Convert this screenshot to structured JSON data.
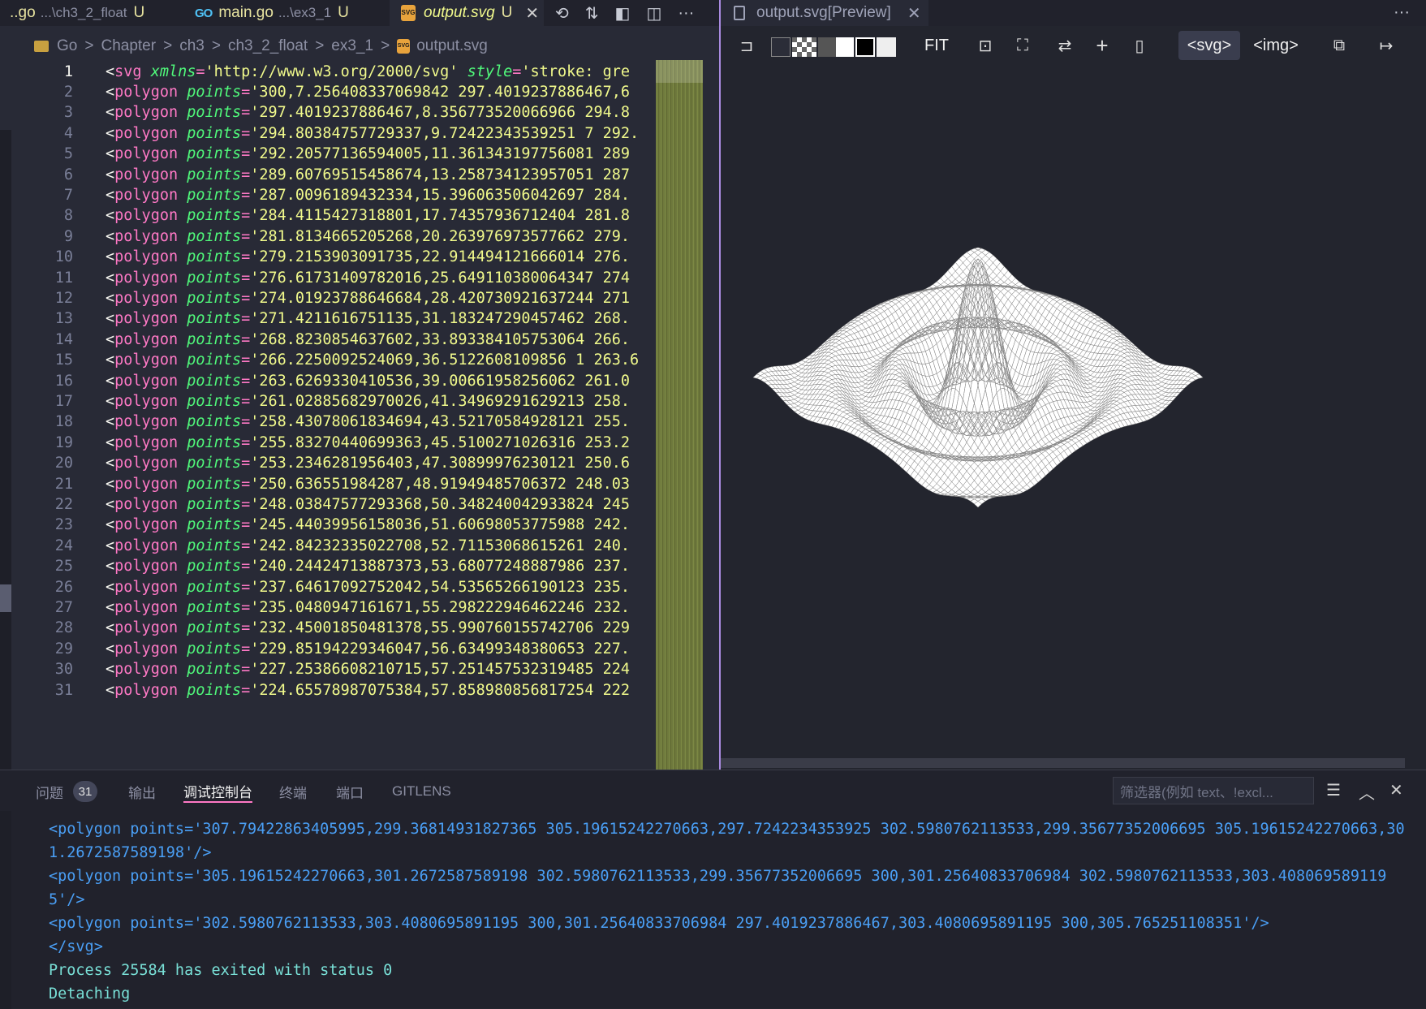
{
  "tabs": [
    {
      "name": "..go",
      "path": "...\\ch3_2_float",
      "mod": "U",
      "icon": "go-icon"
    },
    {
      "name": "main.go",
      "path": "...\\ex3_1",
      "mod": "U",
      "icon": "go-icon"
    },
    {
      "name": "output.svg",
      "path": "",
      "mod": "U",
      "icon": "svg-icon",
      "close": "✕"
    }
  ],
  "editor_actions_more": "···",
  "breadcrumb": [
    "Go",
    "Chapter",
    "ch3",
    "ch3_2_float",
    "ex3_1",
    "output.svg"
  ],
  "breadcrumb_sep": ">",
  "svg_badge": "SVG",
  "go_badge": "GO",
  "code_lines": [
    {
      "n": "1",
      "pre": "<",
      "tag": "svg",
      "a1": "xmlns",
      "v1": "'http://www.w3.org/2000/svg'",
      "a2": "style",
      "v2": "'stroke: gre"
    },
    {
      "n": "2",
      "val": "'300,7.256408337069842 297.4019237886467,6"
    },
    {
      "n": "3",
      "val": "'297.4019237886467,8.356773520066966 294.8"
    },
    {
      "n": "4",
      "val": "'294.80384757729337,9.72422343539251 7 292."
    },
    {
      "n": "5",
      "val": "'292.20577136594005,11.361343197756081 289"
    },
    {
      "n": "6",
      "val": "'289.60769515458674,13.258734123957051 287"
    },
    {
      "n": "7",
      "val": "'287.0096189432334,15.396063506042697 284."
    },
    {
      "n": "8",
      "val": "'284.4115427318801,17.74357936712404 281.8"
    },
    {
      "n": "9",
      "val": "'281.8134665205268,20.263976973577662 279."
    },
    {
      "n": "10",
      "val": "'279.2153903091735,22.914494121666014 276."
    },
    {
      "n": "11",
      "val": "'276.61731409782016,25.649110380064347 274"
    },
    {
      "n": "12",
      "val": "'274.01923788646684,28.420730921637244 271"
    },
    {
      "n": "13",
      "val": "'271.4211616751135,31.183247290457462 268."
    },
    {
      "n": "14",
      "val": "'268.8230854637602,33.893384105753064 266."
    },
    {
      "n": "15",
      "val": "'266.2250092524069,36.5122608109856 1 263.6"
    },
    {
      "n": "16",
      "val": "'263.6269330410536,39.00661958256062 261.0"
    },
    {
      "n": "17",
      "val": "'261.02885682970026,41.34969291629213 258."
    },
    {
      "n": "18",
      "val": "'258.43078061834694,43.52170584928121 255."
    },
    {
      "n": "19",
      "val": "'255.83270440699363,45.5100271026316 253.2"
    },
    {
      "n": "20",
      "val": "'253.2346281956403,47.30899976230121 250.6"
    },
    {
      "n": "21",
      "val": "'250.636551984287,48.91949485706372 248.03"
    },
    {
      "n": "22",
      "val": "'248.03847577293368,50.348240042933824 245"
    },
    {
      "n": "23",
      "val": "'245.44039956158036,51.60698053775988 242."
    },
    {
      "n": "24",
      "val": "'242.84232335022708,52.71153068615261 240."
    },
    {
      "n": "25",
      "val": "'240.24424713887373,53.68077248887986 237."
    },
    {
      "n": "26",
      "val": "'237.64617092752042,54.53565266190123 235."
    },
    {
      "n": "27",
      "val": "'235.0480947161671,55.298222946462246 232."
    },
    {
      "n": "28",
      "val": "'232.45001850481378,55.990760155742706 229"
    },
    {
      "n": "29",
      "val": "'229.85194229346047,56.63499348380653 227."
    },
    {
      "n": "30",
      "val": "'227.25386608210715,57.251457532319485 224"
    },
    {
      "n": "31",
      "val": "'224.65578987075384,57.858980856817254 222"
    }
  ],
  "polygon_tag": "polygon",
  "points_attr": "points",
  "preview": {
    "tab_title": "output.svg[Preview]",
    "close": "✕",
    "more": "···",
    "toolbar": {
      "pin": "⊐",
      "fit": "FIT",
      "fit_icon": "⊡",
      "fullscreen_icon": "⛶",
      "swap_icon": "⇄",
      "plus_icon": "+",
      "panel_icon": "▯",
      "svg_label": "<svg>",
      "img_label": "<img>",
      "copy_icon": "⧉",
      "arrow_icon": "↦"
    }
  },
  "panel": {
    "tabs": [
      "问题",
      "输出",
      "调试控制台",
      "终端",
      "端口",
      "GITLENS"
    ],
    "problems_count": "31",
    "active_tab": "调试控制台",
    "filter_placeholder": "筛选器(例如 text、!excl...",
    "icons": {
      "list": "☰",
      "up": "︿",
      "close": "✕"
    }
  },
  "console_lines": [
    "<polygon points='307.79422863405995,299.36814931827365 305.19615242270663,297.7242234353925 302.5980762113533,299.35677352006695 305.19615242270663,301.2672587589198'/>",
    "<polygon points='305.19615242270663,301.2672587589198 302.5980762113533,299.35677352006695 300,301.25640833706984 302.5980762113533,303.4080695891195'/>",
    "<polygon points='302.5980762113533,303.4080695891195 300,301.25640833706984 297.4019237886467,303.4080695891195 300,305.765251108351'/>",
    "</svg>",
    "Process 25584 has exited with status 0",
    "Detaching"
  ],
  "colors": {
    "accent_pink": "#ff79c6",
    "string_yellow": "#f1fa8c",
    "attr_green": "#50fa7b",
    "console_blue": "#4a9ff5",
    "console_teal": "#79e0d7",
    "divider_purple": "#a98ae0"
  }
}
